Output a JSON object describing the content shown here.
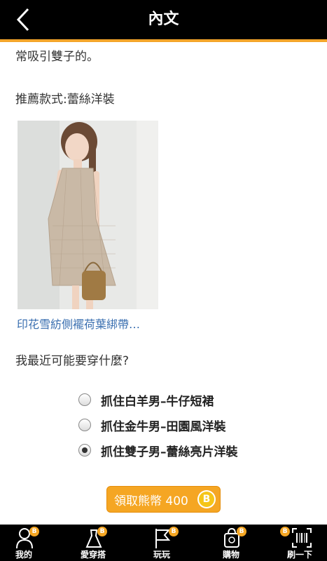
{
  "header": {
    "title": "內文"
  },
  "content": {
    "paragraph_end": "常吸引雙子的。",
    "recommend_label": "推薦款式:蕾絲洋裝",
    "product_link": "印花雪紡側襬荷葉綁帶…",
    "question": "我最近可能要穿什麼?",
    "options": [
      {
        "label": "抓住白羊男–牛仔短裙",
        "checked": false
      },
      {
        "label": "抓住金牛男–田園風洋裝",
        "checked": false
      },
      {
        "label": "抓住雙子男–蕾絲亮片洋裝",
        "checked": true
      }
    ],
    "claim_button": "領取熊幣 400",
    "coin_symbol": "B"
  },
  "bottom_nav": {
    "items": [
      {
        "label": "我的",
        "icon": "person-icon",
        "badge": "B"
      },
      {
        "label": "愛穿搭",
        "icon": "dress-icon",
        "badge": "B"
      },
      {
        "label": "玩玩",
        "icon": "flag-icon",
        "badge": "B"
      },
      {
        "label": "購物",
        "icon": "shopping-bag-icon",
        "badge": "B"
      },
      {
        "label": "刷一下",
        "icon": "barcode-scan-icon",
        "badge": "B"
      }
    ]
  },
  "colors": {
    "accent": "#f5a623",
    "link": "#3a6fb0",
    "header_bg": "#000000"
  }
}
